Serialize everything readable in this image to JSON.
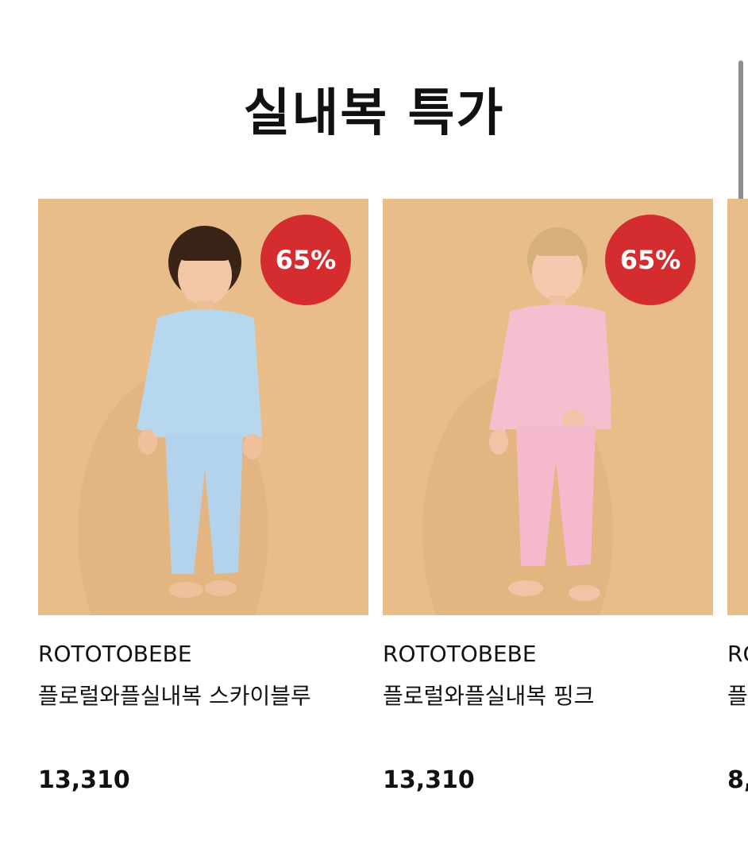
{
  "section": {
    "title": "실내복 특가"
  },
  "products": [
    {
      "brand": "ROTOTOBEBE",
      "name": "플로럴와플실내복 스카이블루",
      "price": "13,310",
      "discount": "65%",
      "pajama_color": "#b7d7ef",
      "image_bg": "#e9bd8a"
    },
    {
      "brand": "ROTOTOBEBE",
      "name": "플로럴와플실내복 핑크",
      "price": "13,310",
      "discount": "65%",
      "pajama_color": "#f5bfd0",
      "image_bg": "#e9bd8a"
    },
    {
      "brand": "RO",
      "name": "플",
      "price": "8,"
    }
  ],
  "colors": {
    "badge": "#d42c2f",
    "text": "#111111",
    "scrollbar": "#8e8e8e"
  }
}
